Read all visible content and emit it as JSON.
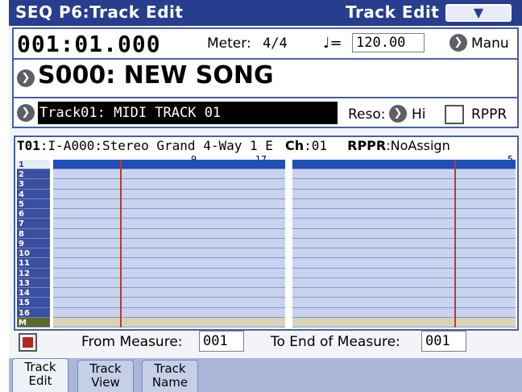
{
  "title_bar": {
    "title": "SEQ P6:Track Edit",
    "page_name": "Track Edit",
    "menu_icon": "chevron-down-icon"
  },
  "locator": {
    "position": "001:01.000",
    "meter_label": "Meter:",
    "meter_value": "4/4",
    "tempo_symbol": "♩=",
    "tempo_value": "120.00",
    "tempo_mode": "Manu"
  },
  "song": {
    "name": "S000: NEW SONG"
  },
  "track_select": {
    "value": "Track01: MIDI TRACK 01",
    "reso_label": "Reso:",
    "reso_value": "Hi",
    "rppr_label": "RPPR",
    "rppr_checked": false
  },
  "track_info": {
    "track_id": "T01",
    "program": ":I-A000:Stereo Grand 4-Way 1 E",
    "ch_label": "Ch",
    "ch_value": ":01",
    "rppr_label": "RPPR",
    "rppr_value": ":NoAssign"
  },
  "track_numbers": [
    "1",
    "2",
    "3",
    "4",
    "5",
    "6",
    "7",
    "8",
    "9",
    "10",
    "11",
    "12",
    "13",
    "14",
    "15",
    "16",
    "M"
  ],
  "ruler_left": [
    "9",
    "17"
  ],
  "ruler_right": [
    "5"
  ],
  "range": {
    "from_label": "From Measure:",
    "from_value": "001",
    "to_label": "To End of Measure:",
    "to_value": "001"
  },
  "tabs": [
    {
      "line1": "Track",
      "line2": "Edit"
    },
    {
      "line1": "Track",
      "line2": "View"
    },
    {
      "line1": "Track",
      "line2": "Name"
    }
  ],
  "colors": {
    "title_bar": "#273d8e",
    "grid": "#c9d3ee",
    "playhead": "#b0402c",
    "selected_track": "#1f4fb8"
  }
}
